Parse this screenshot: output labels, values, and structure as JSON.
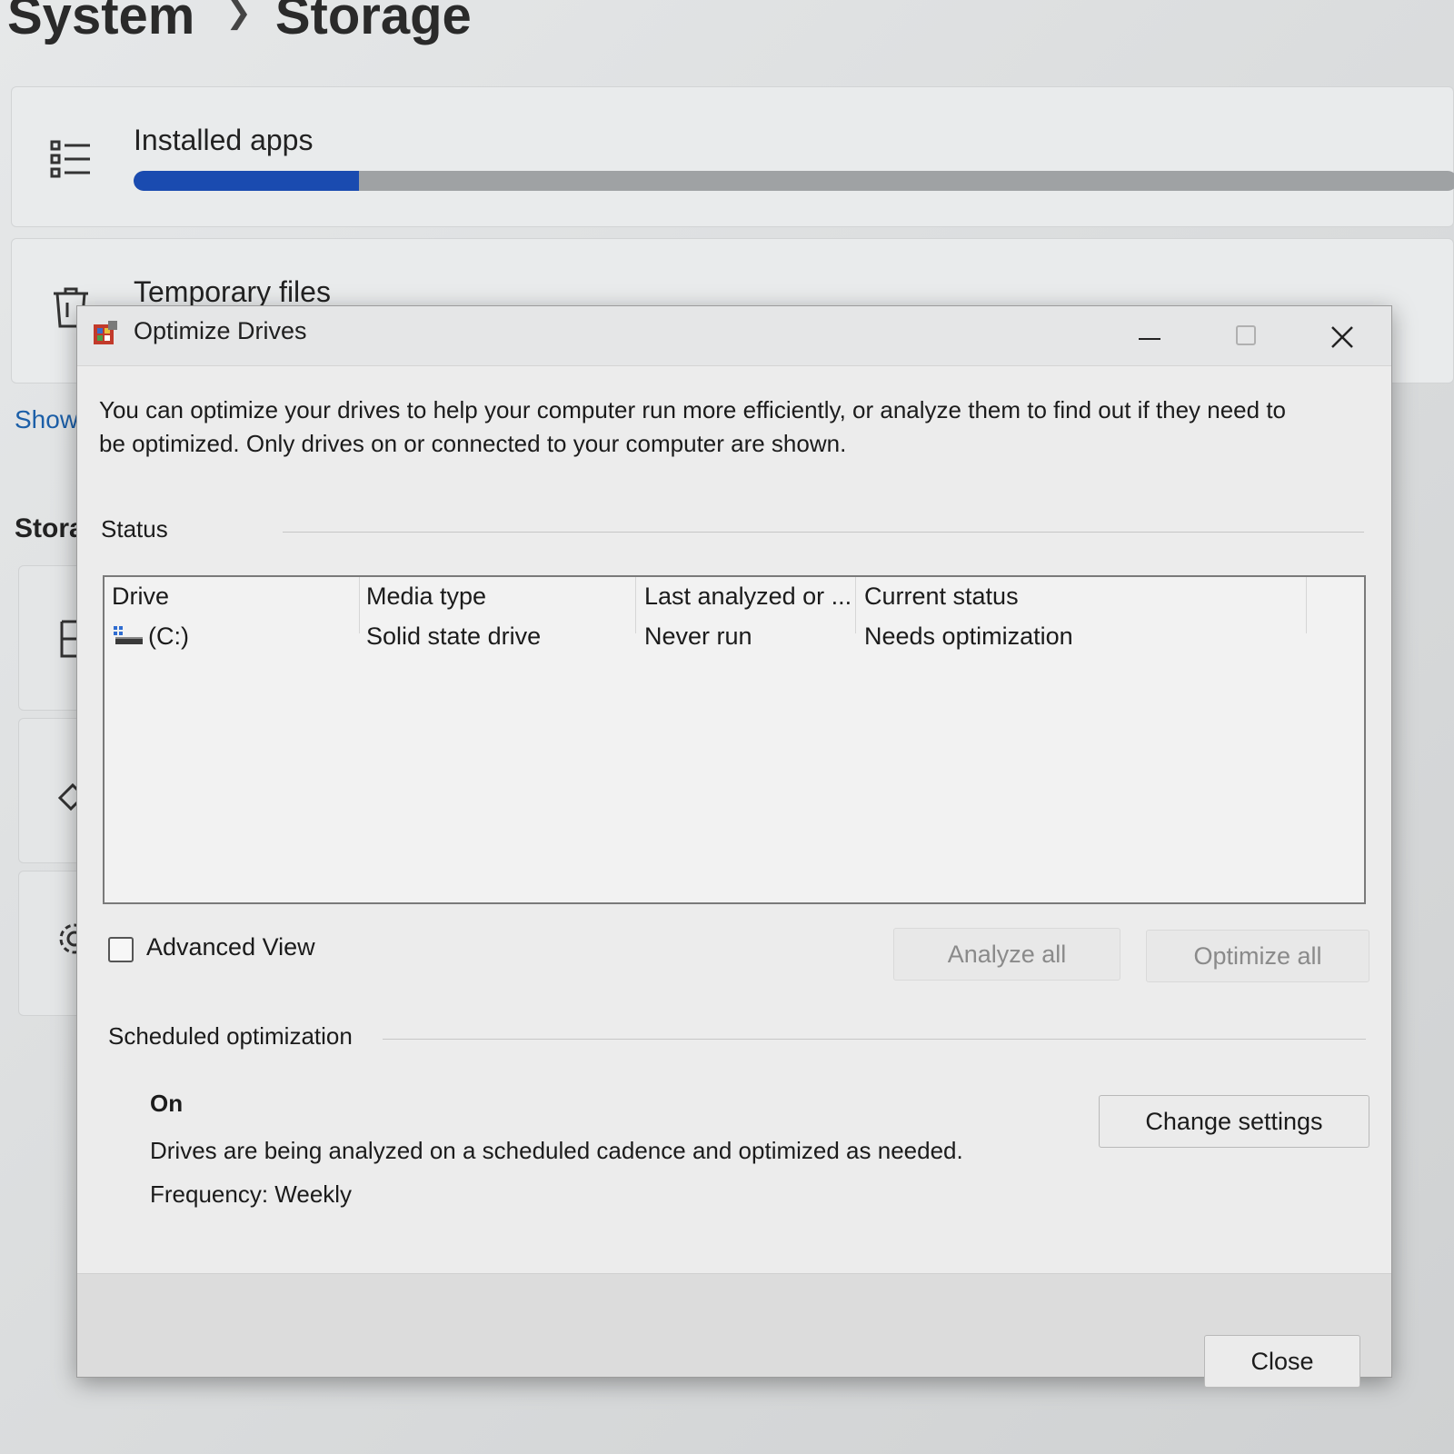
{
  "settings": {
    "breadcrumb": {
      "parent": "System",
      "current": "Storage"
    },
    "installed_apps": {
      "label": "Installed apps",
      "usage_fraction": 0.17
    },
    "temporary_files": {
      "label": "Temporary files"
    },
    "show_link": "Show",
    "storage_heading": "Stora"
  },
  "dialog": {
    "title": "Optimize Drives",
    "intro": "You can optimize your drives to help your computer run more efficiently, or analyze them to find out if they need to be optimized. Only drives on or connected to your computer are shown.",
    "status_group": "Status",
    "columns": [
      "Drive",
      "Media type",
      "Last analyzed or ...",
      "Current status"
    ],
    "drives": [
      {
        "drive": "(C:)",
        "media_type": "Solid state drive",
        "last_analyzed": "Never run",
        "current_status": "Needs optimization"
      }
    ],
    "advanced_view": {
      "label": "Advanced View",
      "checked": false
    },
    "analyze_all": "Analyze all",
    "optimize_all": "Optimize all",
    "scheduled": {
      "group": "Scheduled optimization",
      "state": "On",
      "description": "Drives are being analyzed on a scheduled cadence and optimized as needed.",
      "frequency": "Frequency: Weekly",
      "change_settings": "Change settings"
    },
    "close": "Close"
  },
  "colors": {
    "accent": "#1a4bb0",
    "link": "#1c5fa8"
  },
  "icons": [
    "list-icon",
    "trash-icon",
    "optimize-drives-icon",
    "minimize-icon",
    "maximize-icon",
    "close-icon",
    "drive-icon",
    "gear-icon",
    "brush-icon"
  ]
}
